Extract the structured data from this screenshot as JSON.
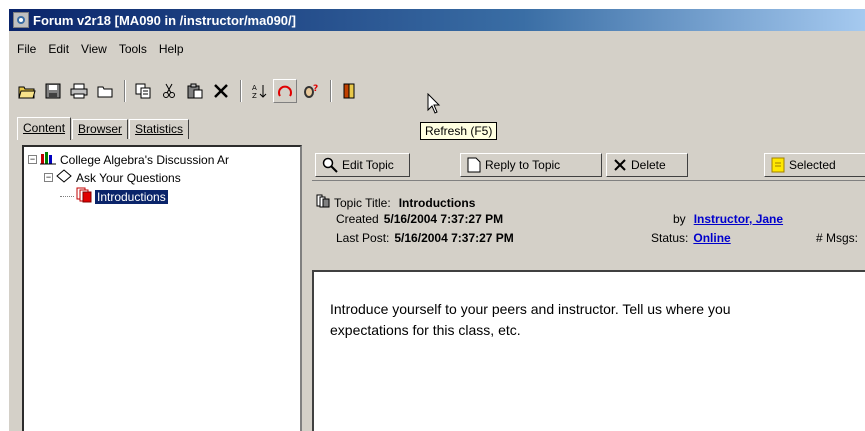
{
  "window": {
    "title": "Forum v2r18  [MA090 in /instructor/ma090/]"
  },
  "menu": [
    "File",
    "Edit",
    "View",
    "Tools",
    "Help"
  ],
  "toolbar": {
    "buttons": [
      "open-folder-icon",
      "save-icon",
      "print-icon",
      "folder-icon",
      "copy-icon",
      "cut-icon",
      "paste-icon",
      "delete-x-icon",
      "sort-icon",
      "refresh-icon",
      "help-icon",
      "exit-door-icon"
    ],
    "tooltip": "Refresh (F5)"
  },
  "tabs": [
    "Content",
    "Browser",
    "Statistics"
  ],
  "tree": {
    "root": "College Algebra's Discussion Ar",
    "forum": "Ask Your Questions",
    "topic": "Introductions"
  },
  "topic_toolbar": {
    "edit": "Edit Topic",
    "reply": "Reply to Topic",
    "delete": "Delete",
    "selected": "Selected"
  },
  "topic": {
    "title_label": "Topic Title:",
    "title": "Introductions",
    "created_label": "Created",
    "created": "5/16/2004 7:37:27 PM",
    "by_label": "by",
    "author": "Instructor, Jane",
    "last_post_label": "Last Post:",
    "last_post": "5/16/2004 7:37:27 PM",
    "status_label": "Status:",
    "status": "Online",
    "msgs_label": "# Msgs:"
  },
  "message": {
    "line1": "Introduce yourself to your peers and instructor.  Tell us where you",
    "line2": "expectations for this class, etc."
  },
  "colors": {
    "titlebar": "#0a246a",
    "face": "#d4d0c8",
    "link": "#0000cc",
    "selection": "#0a246a"
  }
}
